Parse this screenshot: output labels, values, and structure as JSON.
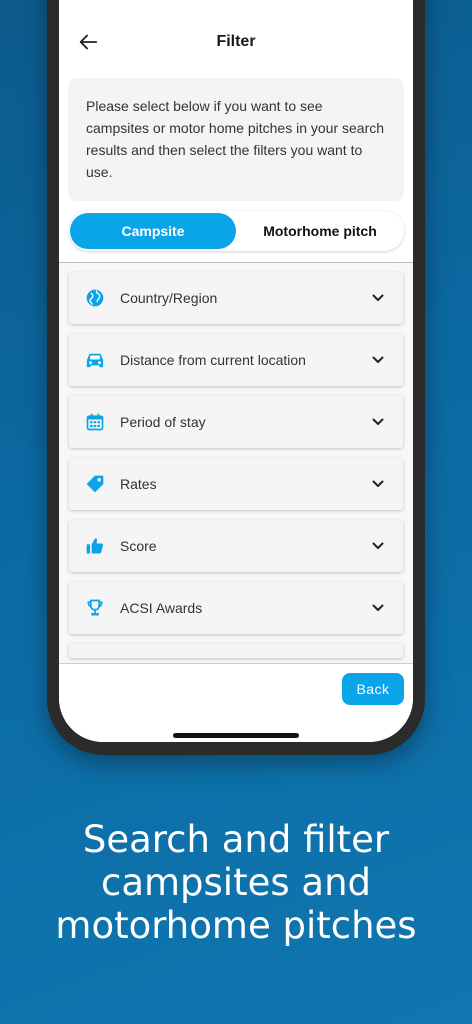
{
  "header": {
    "title": "Filter",
    "back_icon": "arrow-left-icon"
  },
  "intro_text": "Please select below if you want to see campsites or motor home pitches in your search results and then select the filters you want to use.",
  "segment": {
    "options": [
      "Campsite",
      "Motorhome pitch"
    ],
    "selected": "Campsite"
  },
  "filters": [
    {
      "label": "Country/Region",
      "icon": "globe-icon"
    },
    {
      "label": "Distance from current location",
      "icon": "car-icon"
    },
    {
      "label": "Period of stay",
      "icon": "calendar-icon"
    },
    {
      "label": "Rates",
      "icon": "price-tag-icon"
    },
    {
      "label": "Score",
      "icon": "thumbs-up-icon"
    },
    {
      "label": "ACSI Awards",
      "icon": "trophy-icon"
    }
  ],
  "footer": {
    "back_label": "Back"
  },
  "caption": {
    "lines": [
      "Search and filter",
      "campsites and",
      "motorhome pitches"
    ]
  },
  "colors": {
    "accent": "#0aa5e8",
    "background": "#0b6aa3"
  }
}
